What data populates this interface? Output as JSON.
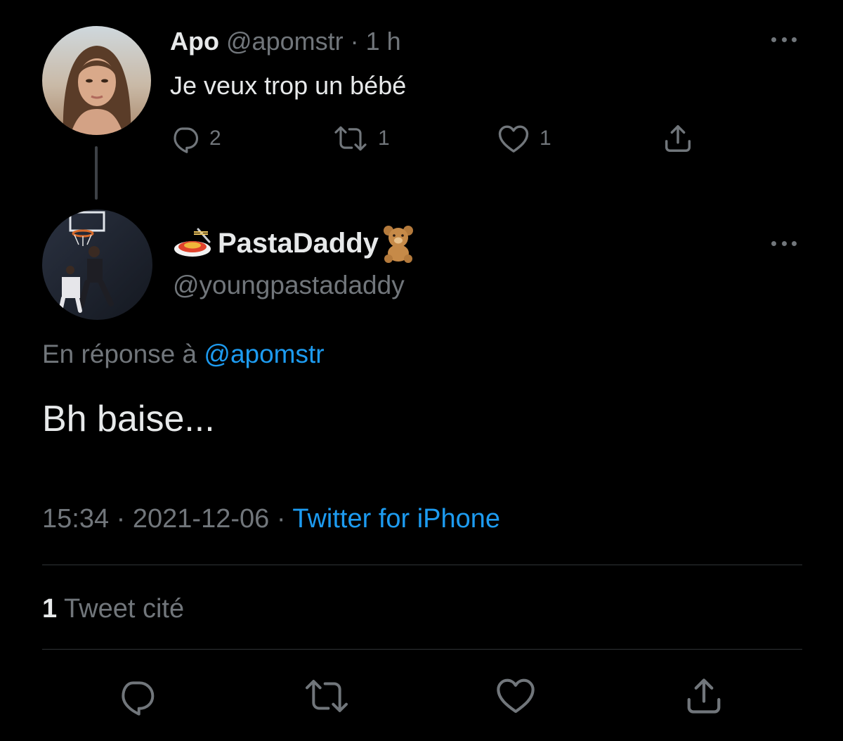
{
  "parent_tweet": {
    "display_name": "Apo",
    "handle": "@apomstr",
    "separator": "·",
    "time_ago": "1 h",
    "text": "Je veux trop un bébé",
    "reply_count": "2",
    "retweet_count": "1",
    "like_count": "1"
  },
  "main_tweet": {
    "name_emoji_prefix": "spaghetti-emoji",
    "display_name": "PastaDaddy",
    "name_emoji_suffix": "teddy-bear-emoji",
    "handle": "@youngpastadaddy",
    "reply_prefix": "En réponse à",
    "reply_to_handle": "@apomstr",
    "text": "Bh baise...",
    "time": "15:34",
    "dot1": "·",
    "date": "2021-12-06",
    "dot2": "·",
    "source": "Twitter for iPhone",
    "quote_count": "1",
    "quote_label": "Tweet cité"
  },
  "icons": {
    "reply": "reply-icon",
    "retweet": "retweet-icon",
    "like": "heart-icon",
    "share": "share-icon",
    "more": "more-icon"
  },
  "colors": {
    "background": "#000000",
    "text": "#e7e9ea",
    "muted": "#71767b",
    "link": "#1d9bf0",
    "divider": "#2f3336"
  }
}
